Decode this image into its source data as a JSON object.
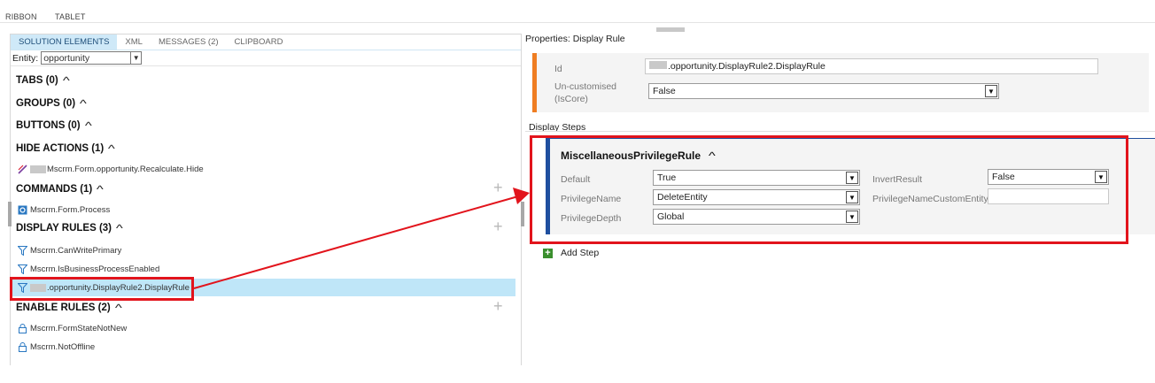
{
  "ribbon_tabs": [
    "RIBBON",
    "TABLET"
  ],
  "left": {
    "tabs": [
      "SOLUTION ELEMENTS",
      "XML",
      "MESSAGES (2)",
      "CLIPBOARD"
    ],
    "entity_label": "Entity:",
    "entity_value": "opportunity",
    "sections": {
      "tabs": "TABS (0)",
      "groups": "GROUPS (0)",
      "buttons": "BUTTONS (0)",
      "hide_actions": "HIDE ACTIONS (1)",
      "commands": "COMMANDS (1)",
      "display_rules": "DISPLAY RULES (3)",
      "enable_rules": "ENABLE RULES (2)"
    },
    "items": {
      "hide_action": "Mscrm.Form.opportunity.Recalculate.Hide",
      "command": "Mscrm.Form.Process",
      "display_rule_1": "Mscrm.CanWritePrimary",
      "display_rule_2": "Mscrm.IsBusinessProcessEnabled",
      "display_rule_3": ".opportunity.DisplayRule2.DisplayRule",
      "enable_rule_1": "Mscrm.FormStateNotNew",
      "enable_rule_2": "Mscrm.NotOffline"
    }
  },
  "right": {
    "header": "Properties: Display Rule",
    "id_label": "Id",
    "id_value": ".opportunity.DisplayRule2.DisplayRule",
    "iscore_label_1": "Un-customised",
    "iscore_label_2": "(IsCore)",
    "iscore_value": "False",
    "steps_header": "Display Steps",
    "step": {
      "title": "MiscellaneousPrivilegeRule",
      "default_label": "Default",
      "default_value": "True",
      "privilege_name_label": "PrivilegeName",
      "privilege_name_value": "DeleteEntity",
      "privilege_depth_label": "PrivilegeDepth",
      "privilege_depth_value": "Global",
      "invert_label": "InvertResult",
      "invert_value": "False",
      "custom_entity_label": "PrivilegeNameCustomEntity",
      "custom_entity_value": ""
    },
    "add_step": "Add Step"
  },
  "colors": {
    "highlight": "#e2141c",
    "selected_row": "#bfe6f8",
    "accent_orange": "#ef7d22",
    "accent_blue": "#1f4f9f",
    "active_tab": "#cfe9f8"
  }
}
